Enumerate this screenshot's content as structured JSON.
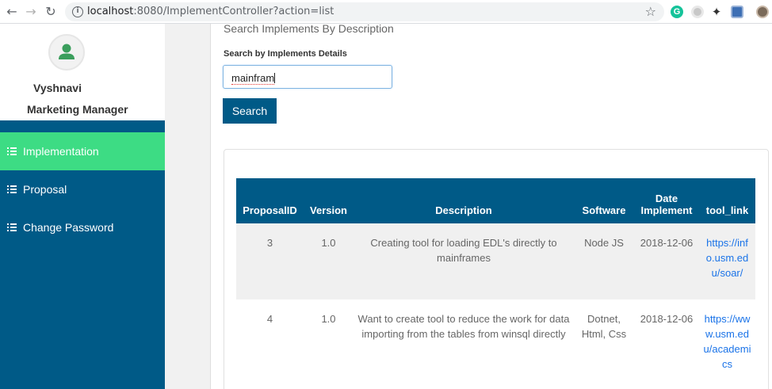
{
  "browser": {
    "url_host": "localhost",
    "url_path": ":8080/ImplementController?action=list"
  },
  "sidebar": {
    "user_name": "Vyshnavi",
    "user_role": "Marketing Manager",
    "items": [
      {
        "label": "Implementation"
      },
      {
        "label": "Proposal"
      },
      {
        "label": "Change Password"
      }
    ]
  },
  "main": {
    "title": "Search Implements By Description",
    "search_label": "Search by Implements Details",
    "search_value": "mainfram",
    "search_button": "Search"
  },
  "table": {
    "headers": [
      "ProposalID",
      "Version",
      "Description",
      "Software",
      "Date Implement",
      "tool_link"
    ],
    "rows": [
      {
        "proposal_id": "3",
        "version": "1.0",
        "description": "Creating tool for loading EDL's directly to mainframes",
        "software": "Node JS",
        "date": "2018-12-06",
        "tool_link": "https://info.usm.edu/soar/"
      },
      {
        "proposal_id": "4",
        "version": "1.0",
        "description": "Want to create tool to reduce the work for data importing from the tables from winsql directly",
        "software": "Dotnet, Html, Css",
        "date": "2018-12-06",
        "tool_link": "https://www.usm.edu/academics"
      }
    ]
  },
  "colors": {
    "primary": "#005a87",
    "active_menu": "#3ddc84",
    "link": "#1a73e8"
  },
  "icons": [
    "back-arrow-icon",
    "forward-arrow-icon",
    "reload-icon",
    "info-icon",
    "star-icon",
    "grammarly-extension-icon",
    "extension-circle-icon",
    "extension-pin-icon",
    "extension-shield-icon",
    "profile-avatar-icon",
    "user-icon",
    "list-icon"
  ]
}
